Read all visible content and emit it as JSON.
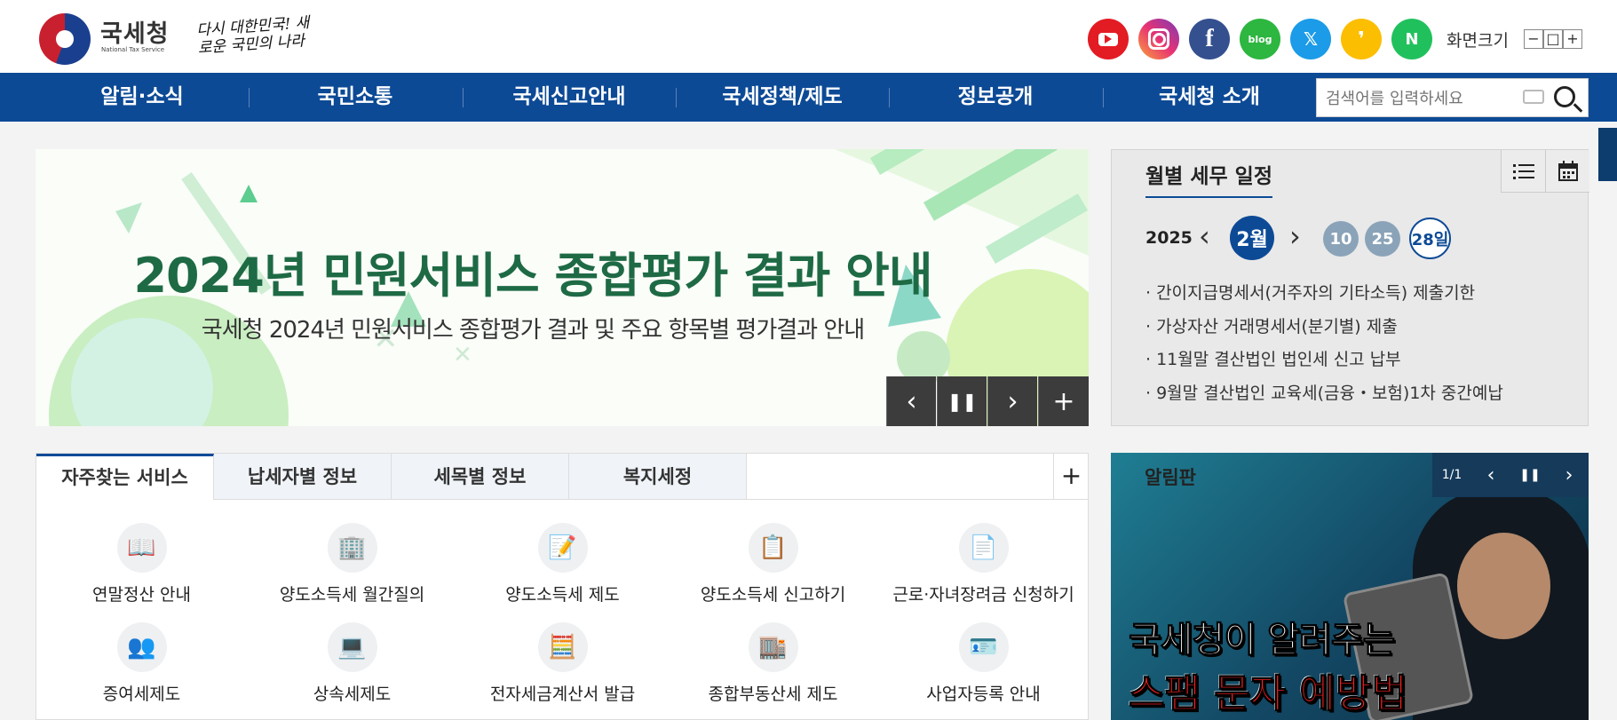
{
  "header": {
    "logo_text": "국세청",
    "logo_subtext": "National Tax Service",
    "slogan": "다시 대한민국! 새로운 국민의 나라",
    "screen_size_label": "화면크기",
    "zoom_out": "−",
    "zoom_reset": "□",
    "zoom_in": "+",
    "sns": [
      {
        "name": "youtube-icon"
      },
      {
        "name": "instagram-icon"
      },
      {
        "name": "facebook-icon",
        "glyph": "f"
      },
      {
        "name": "blog-icon",
        "glyph": "blog"
      },
      {
        "name": "x-icon",
        "glyph": "𝕏"
      },
      {
        "name": "kakao-story-icon",
        "glyph": "❜"
      },
      {
        "name": "naver-band-icon",
        "glyph": "N"
      }
    ]
  },
  "gnb": {
    "items": [
      "알림·소식",
      "국민소통",
      "국세신고안내",
      "국세정책/제도",
      "정보공개",
      "국세청 소개"
    ],
    "search_placeholder": "검색어를 입력하세요"
  },
  "banner": {
    "title": "2024년 민원서비스 종합평가 결과 안내",
    "subtitle": "국세청 2024년 민원서비스 종합평가 결과 및 주요 항목별 평가결과 안내",
    "controls": {
      "prev": "‹",
      "pause": "❚❚",
      "next": "›",
      "more": "+"
    }
  },
  "schedule": {
    "title": "월별 세무 일정",
    "year": "2025",
    "month": "2월",
    "days": [
      "10",
      "25",
      "28일"
    ],
    "items": [
      "· 간이지급명세서(거주자의 기타소득) 제출기한",
      "· 가상자산 거래명세서(분기별) 제출",
      "· 11월말 결산법인 법인세 신고 납부",
      "· 9월말 결산법인 교육세(금융・보험)1차 중간예납"
    ]
  },
  "services": {
    "tabs": [
      "자주찾는 서비스",
      "납세자별 정보",
      "세목별 정보",
      "복지세정"
    ],
    "more": "+",
    "items": [
      {
        "label": "연말정산 안내",
        "icon": "book-monitor-icon",
        "glyph": "📖"
      },
      {
        "label": "양도소득세 월간질의",
        "icon": "building-icon",
        "glyph": "🏢"
      },
      {
        "label": "양도소득세 제도",
        "icon": "document-pen-icon",
        "glyph": "📝"
      },
      {
        "label": "양도소득세 신고하기",
        "icon": "document-list-icon",
        "glyph": "📋"
      },
      {
        "label": "근로·자녀장려금 신청하기",
        "icon": "form-edit-icon",
        "glyph": "📄"
      },
      {
        "label": "증여세제도",
        "icon": "people-exchange-icon",
        "glyph": "👥"
      },
      {
        "label": "상속세제도",
        "icon": "laptop-coin-icon",
        "glyph": "💻"
      },
      {
        "label": "전자세금계산서 발급",
        "icon": "calculator-icon",
        "glyph": "🧮"
      },
      {
        "label": "종합부동산세 제도",
        "icon": "buildings-icon",
        "glyph": "🏬"
      },
      {
        "label": "사업자등록 안내",
        "icon": "id-card-icon",
        "glyph": "🪪"
      }
    ]
  },
  "notice": {
    "title": "알림판",
    "counter": "1/1",
    "line1": "국세청이 알려주는",
    "line2": "스팸 문자 예방법",
    "controls": {
      "prev": "‹",
      "pause": "❚❚",
      "next": "›"
    }
  }
}
